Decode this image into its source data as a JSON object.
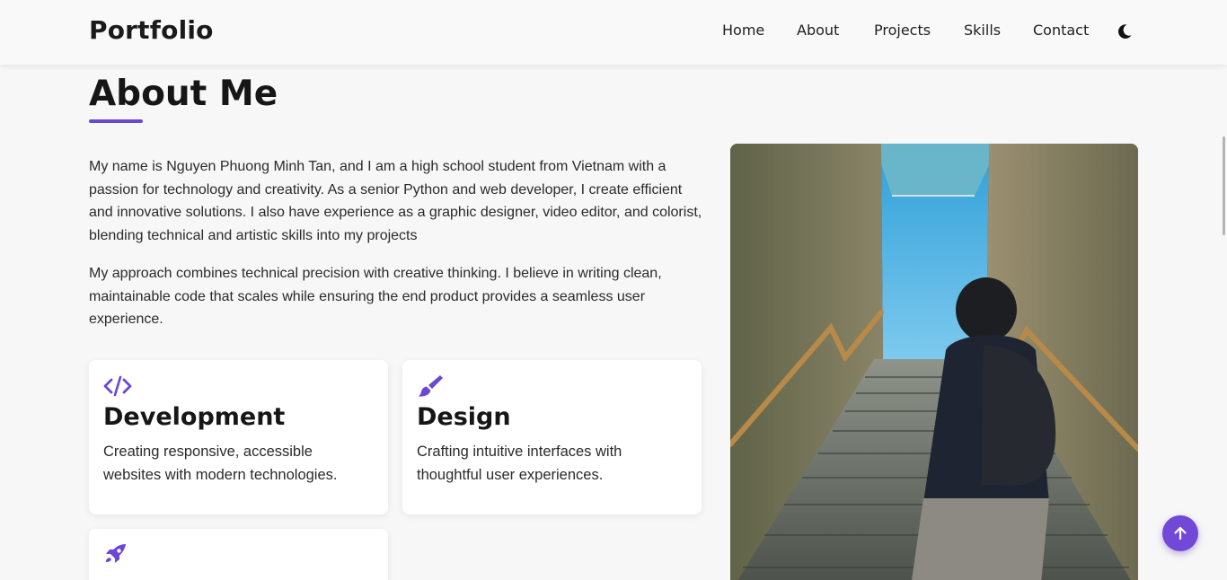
{
  "header": {
    "logo": "Portfolio",
    "nav": [
      {
        "label": "Home"
      },
      {
        "label": "About"
      },
      {
        "label": "Projects"
      },
      {
        "label": "Skills"
      },
      {
        "label": "Contact"
      }
    ],
    "theme_icon": "moon-icon"
  },
  "about": {
    "title": "About Me",
    "accent_color": "#6b47d6",
    "paragraphs": [
      "My name is Nguyen Phuong Minh Tan, and I am a high school student from Vietnam with a passion for technology and creativity. As a senior Python and web developer, I create efficient and innovative solutions. I also have experience as a graphic designer, video editor, and colorist, blending technical and artistic skills into my projects",
      "My approach combines technical precision with creative thinking. I believe in writing clean, maintainable code that scales while ensuring the end product provides a seamless user experience."
    ],
    "cards": [
      {
        "icon": "code-icon",
        "title": "Development",
        "desc": "Creating responsive, accessible websites with modern technologies."
      },
      {
        "icon": "paintbrush-icon",
        "title": "Design",
        "desc": "Crafting intuitive interfaces with thoughtful user experiences."
      },
      {
        "icon": "rocket-icon",
        "title": "",
        "desc": ""
      }
    ]
  },
  "scroll_top_icon": "arrow-up-icon"
}
